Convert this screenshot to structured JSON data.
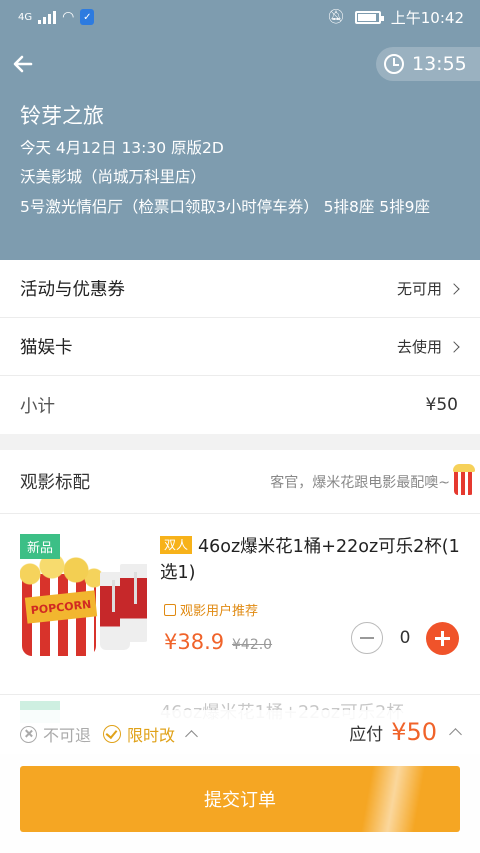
{
  "status_bar": {
    "network": "4G",
    "time": "上午10:42"
  },
  "countdown": "13:55",
  "movie": {
    "title": "铃芽之旅",
    "showtime": "今天 4月12日 13:30 原版2D",
    "cinema": "沃美影城（尚城万科里店）",
    "hall_seats": "5号激光情侣厅（检票口领取3小时停车券） 5排8座 5排9座"
  },
  "rows": [
    {
      "label": "活动与优惠券",
      "value": "无可用"
    },
    {
      "label": "猫娱卡",
      "value": "去使用"
    },
    {
      "label": "小计",
      "value": "¥50"
    }
  ],
  "snacks": {
    "title": "观影标配",
    "slogan": "客官，爆米花跟电影最配噢~",
    "product": {
      "new_tag": "新品",
      "pair_badge": "双人",
      "name": "46oz爆米花1桶+22oz可乐2杯(1选1)",
      "recommend": "观影用户推荐",
      "price": "¥38.9",
      "old_price": "¥42.0",
      "quantity": "0",
      "image_text": "POPCORN"
    },
    "next_product_name": "46oz爆米花1桶+22oz可乐2杯"
  },
  "footer": {
    "no_refund": "不可退",
    "limited_change": "限时改",
    "due_label": "应付",
    "due_amount": "¥50",
    "submit_label": "提交订单"
  },
  "colors": {
    "header_bg": "#7e9caf",
    "accent": "#f0632a",
    "submit": "#f5a623",
    "new_tag": "#3cbf86"
  }
}
